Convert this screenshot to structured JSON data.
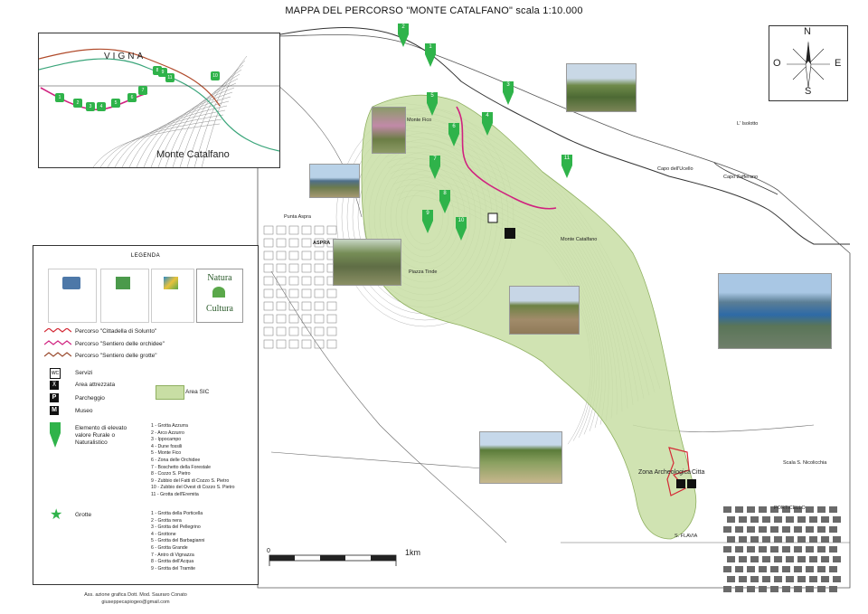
{
  "title": "MAPPA DEL PERCORSO \"MONTE CATALFANO\" scala 1:10.000",
  "compass": {
    "n": "N",
    "s": "S",
    "e": "E",
    "o": "O"
  },
  "colors": {
    "sic_area": "#c8dea4",
    "route_solunto": "#d42a36",
    "route_orchidee": "#d0217f",
    "route_grotte": "#9a4a2e",
    "marker": "#2fb34a",
    "water": "#ffffff"
  },
  "place_labels": [
    "Monte Fico",
    "Monte Catalfano",
    "Punta Aspra",
    "ASPRA",
    "Piazza Tinde",
    "Capo Zafferano",
    "L' Isolotto",
    "Zona Archeologica",
    "Citta",
    "S. FLAVIA",
    "PORTICELLO",
    "Scala S. Nicolicchia",
    "Capo dell'Ucello"
  ],
  "inset": {
    "label_main": "Monte Catalfano",
    "label_sign": "VIGNA",
    "markers": [
      "1",
      "2",
      "3",
      "4",
      "5",
      "6",
      "7",
      "8",
      "9",
      "10",
      "11"
    ]
  },
  "map_markers": [
    "1",
    "2",
    "3",
    "4",
    "5",
    "6",
    "7",
    "8",
    "9",
    "10",
    "11"
  ],
  "scale_bar": {
    "start": "0",
    "end": "1km"
  },
  "legend": {
    "title": "LEGENDA",
    "logos": {
      "natura_top": "Natura",
      "natura_bottom": "Cultura"
    },
    "routes": [
      "Percorso \"Cittadella di Solunto\"",
      "Percorso \"Sentiero delle orchidee\"",
      "Percorso \"Sentiero delle grotte\""
    ],
    "services": [
      {
        "icon": "WC",
        "label": "Servizi"
      },
      {
        "icon": "⊼",
        "label": "Area attrezzata"
      },
      {
        "icon": "P",
        "label": "Parcheggio"
      },
      {
        "icon": "M",
        "label": "Museo"
      }
    ],
    "sic_label": "Area SIC",
    "element_label": "Elemento di elevato valore Rurale o Naturalistico",
    "elements": [
      "1 - Grotta Azzurra",
      "2 - Arco Azzurro",
      "3 - Ippocampo",
      "4 - Dune fossili",
      "5 - Monte Fico",
      "6 - Zona delle Orchidee",
      "7 - Boschetto della Forestale",
      "8 - Cozzo S. Pietro",
      "9 - Zubbio del Fatti di Cozzo S. Pietro",
      "10 - Zubbio del Ovest di Cozzo S. Pietro",
      "11 - Grotta dell'Eremita"
    ],
    "grotte_label": "Grotte",
    "grotte": [
      "1 - Grotta della Porticella",
      "2 - Grotta nera",
      "3 - Grotta del Pellegrino",
      "4 - Grottone",
      "5 - Grotta del Barbagianni",
      "6 - Grotta Grande",
      "7 - Antro di Vignazza",
      "8 - Grotta dell'Acqua",
      "9 - Grotta del Tramite"
    ]
  },
  "credit": {
    "line1": "Ass. azione grafica Dott. Mod. Sauraro Conato",
    "line2": "giuseppecapiogeo@gmail.com"
  }
}
